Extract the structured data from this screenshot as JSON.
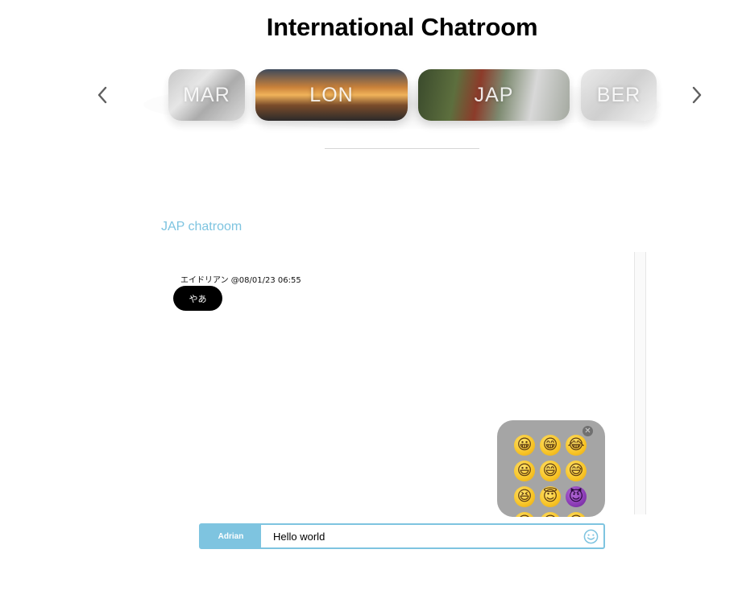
{
  "page": {
    "title": "International Chatroom"
  },
  "carousel": {
    "cities": [
      {
        "label": "MAR"
      },
      {
        "label": "LON"
      },
      {
        "label": "JAP"
      },
      {
        "label": "BER"
      }
    ],
    "prev_icon": "chevron-left-icon",
    "next_icon": "chevron-right-icon"
  },
  "room": {
    "title": "JAP chatroom"
  },
  "messages": [
    {
      "meta": "エイドリアン @08/01/23 06:55",
      "text": "やあ"
    }
  ],
  "emoji_picker": {
    "close_icon": "close-icon",
    "emojis": [
      "😀",
      "😁",
      "😂",
      "😃",
      "😄",
      "😅",
      "😆",
      "😇",
      "😈",
      "😉",
      "😊",
      "😋"
    ]
  },
  "composer": {
    "username": "Adrian",
    "input_value": "Hello world",
    "emoji_button_icon": "smiley-icon"
  },
  "colors": {
    "accent": "#7ec4e0",
    "bubble": "#000000",
    "emoji_panel": "#a5a5a5"
  }
}
